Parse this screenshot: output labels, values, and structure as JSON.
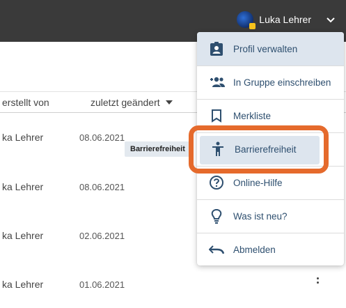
{
  "header": {
    "user_name": "Luka Lehrer"
  },
  "table": {
    "columns": {
      "created_by": "erstellt von",
      "last_modified": "zuletzt geändert"
    },
    "rows": [
      {
        "name": "ka Lehrer",
        "date": "08.06.2021"
      },
      {
        "name": "ka Lehrer",
        "date": "08.06.2021"
      },
      {
        "name": "ka Lehrer",
        "date": "02.06.2021"
      },
      {
        "name": "ka Lehrer",
        "date": "01.06.2021"
      }
    ],
    "tooltip": "Barrierefreiheit"
  },
  "menu": {
    "items": [
      {
        "label": "Profil verwalten",
        "icon": "id-badge-icon"
      },
      {
        "label": "In Gruppe einschreiben",
        "icon": "group-add-icon"
      },
      {
        "label": "Merkliste",
        "icon": "bookmark-icon"
      },
      {
        "label": "Barrierefreiheit",
        "icon": "accessibility-icon"
      },
      {
        "label": "Online-Hilfe",
        "icon": "help-circle-icon"
      },
      {
        "label": "Was ist neu?",
        "icon": "lightbulb-icon"
      },
      {
        "label": "Abmelden",
        "icon": "undo-icon"
      }
    ]
  },
  "colors": {
    "highlight": "#e56a2c",
    "menu_text": "#2e4f6f",
    "topbar": "#3a3a3a"
  }
}
